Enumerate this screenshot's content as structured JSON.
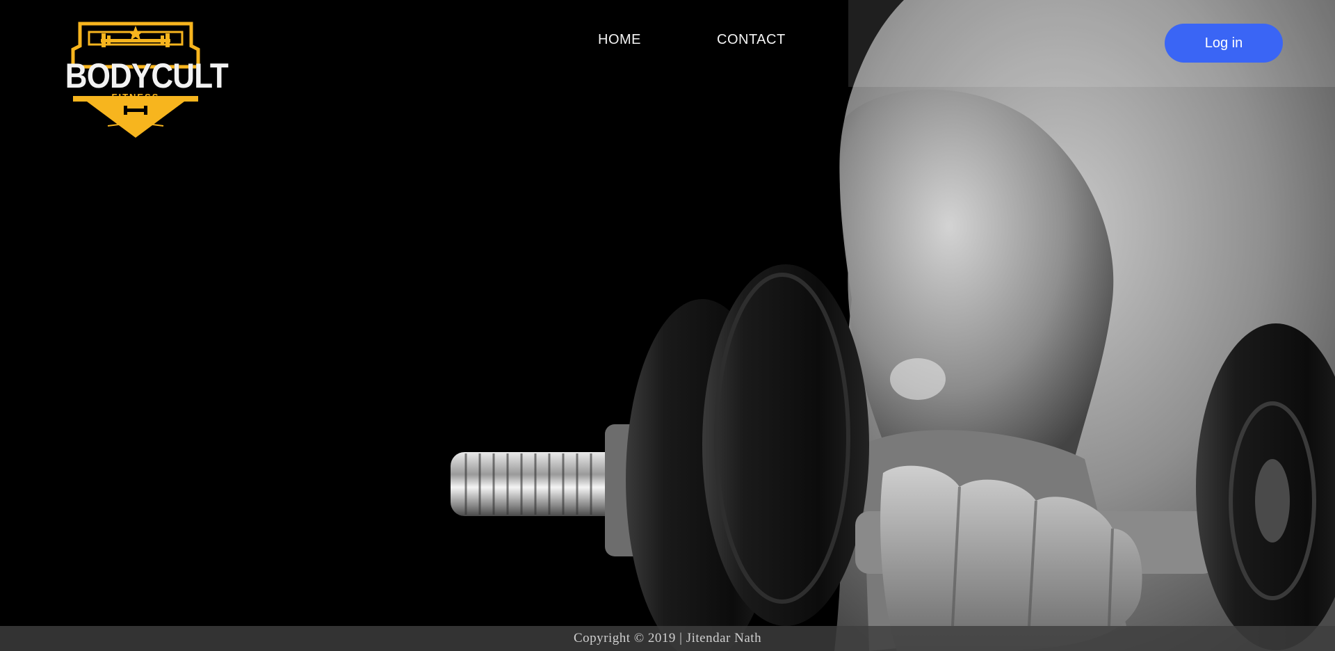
{
  "brand": {
    "name": "BODYCULT",
    "tagline": "FITNESS",
    "accent_color": "#f7b51e"
  },
  "nav": {
    "items": [
      {
        "label": "HOME"
      },
      {
        "label": "CONTACT"
      }
    ]
  },
  "header": {
    "login_label": "Log in",
    "login_color": "#3a65f5"
  },
  "hero": {
    "image_subject": "black-and-white photo of an arm curling a dumbbell",
    "icon": "dumbbell-icon"
  },
  "footer": {
    "copyright": "Copyright © 2019 | Jitendar Nath"
  }
}
